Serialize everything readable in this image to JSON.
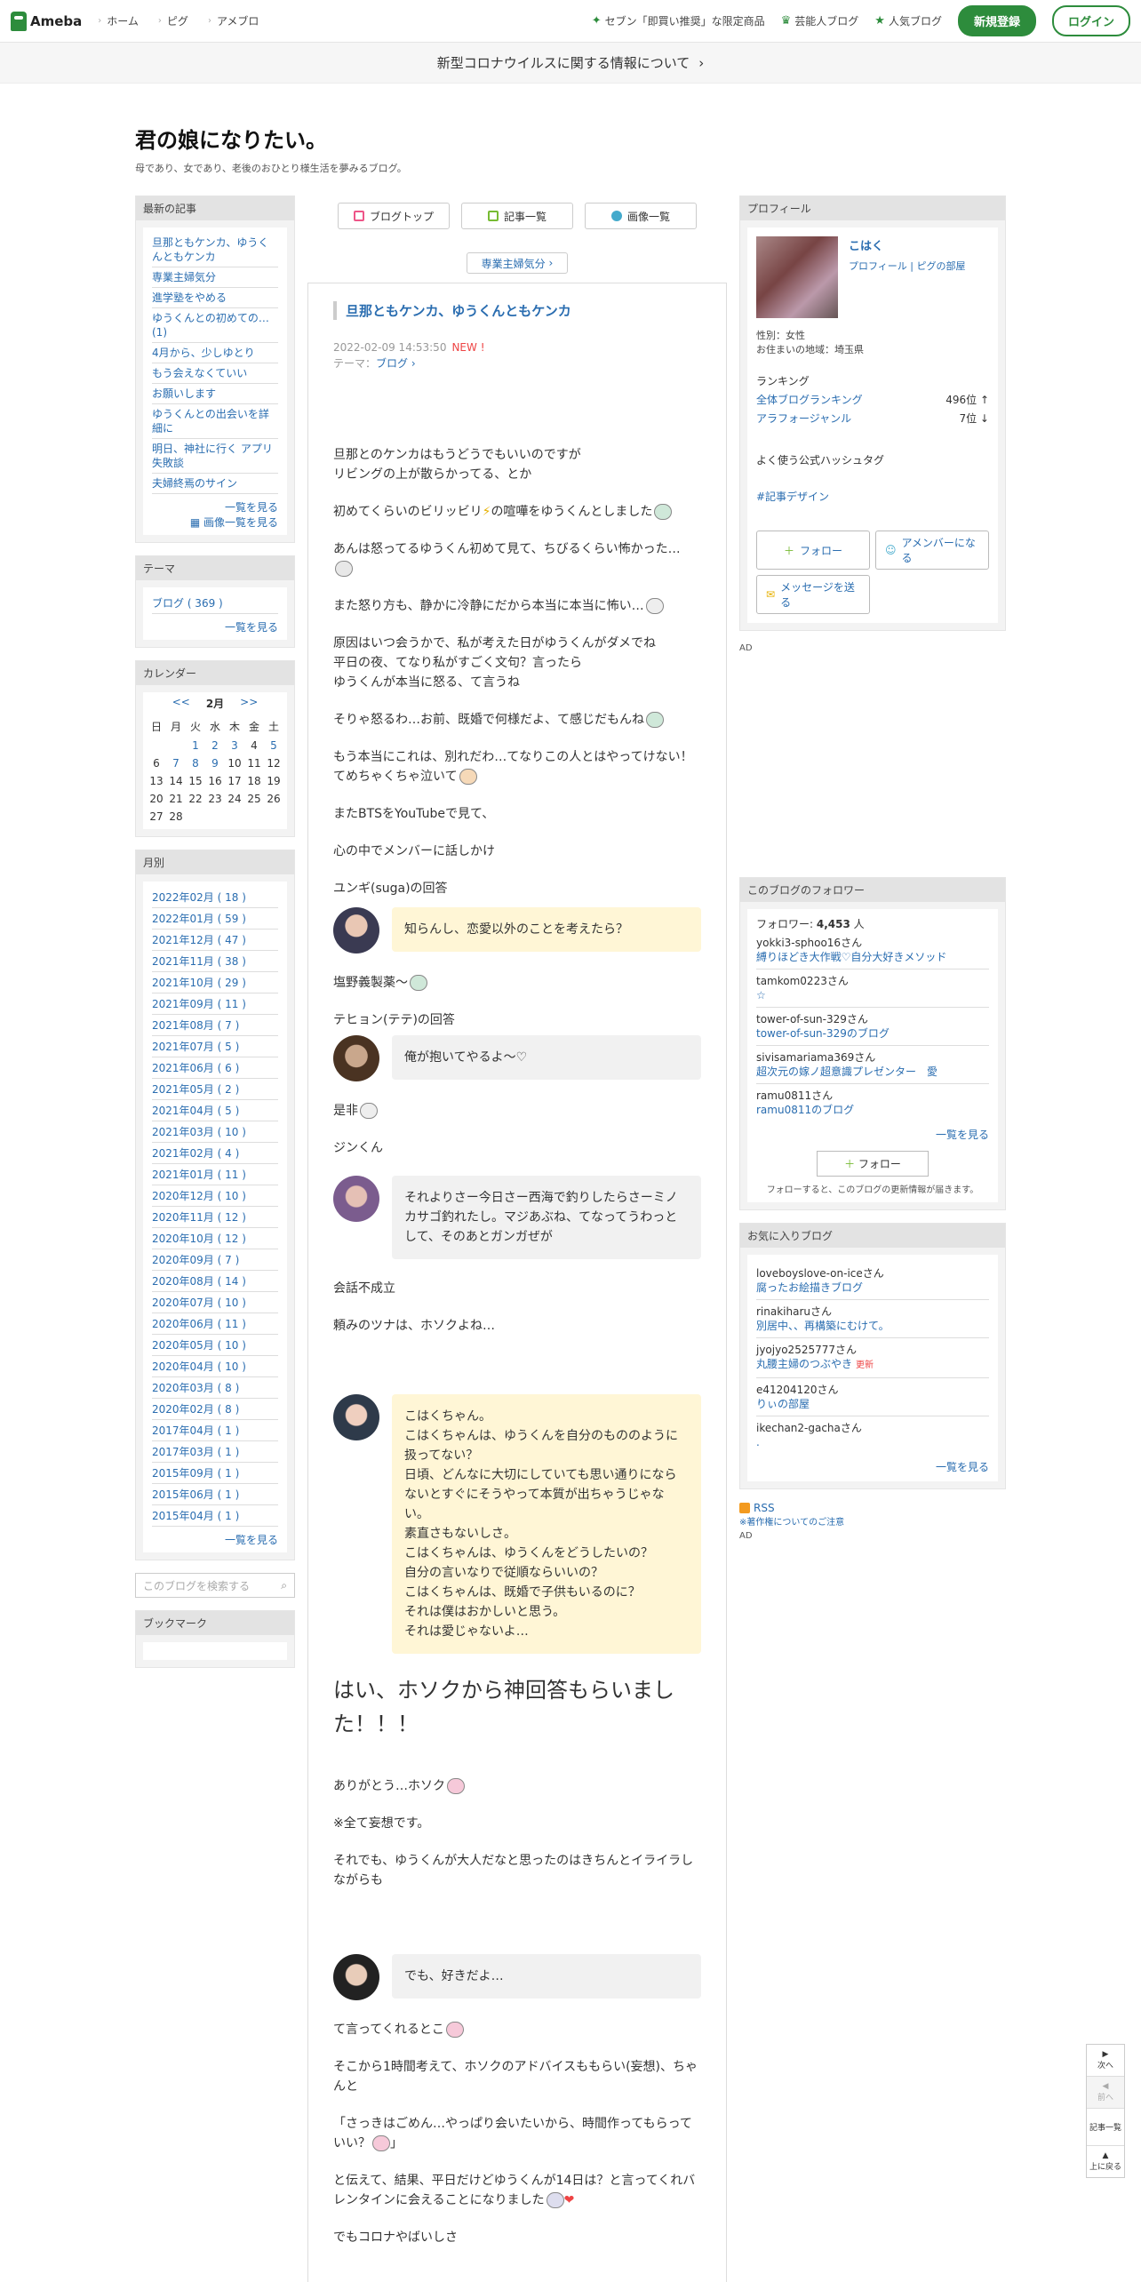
{
  "header": {
    "logo": "Ameba",
    "nav": [
      "ホーム",
      "ピグ",
      "アメブロ"
    ],
    "promos": [
      "セブン「即買い推奨」な限定商品",
      "芸能人ブログ",
      "人気ブログ"
    ],
    "register": "新規登録",
    "login": "ログイン"
  },
  "notice": "新型コロナウイルスに関する情報について",
  "blog": {
    "title": "君の娘になりたい。",
    "desc": "母であり、女であり、老後のおひとり様生活を夢みるブログ。"
  },
  "left": {
    "recent_title": "最新の記事",
    "recent": [
      "旦那ともケンカ、ゆうくんともケンカ",
      "専業主婦気分",
      "進学塾をやめる",
      "ゆうくんとの初めての…(1)",
      "4月から、少しゆとり",
      "もう会えなくていい",
      "お願いします",
      "ゆうくんとの出会いを詳細に",
      "明日、神社に行く アプリ失敗談",
      "夫婦終焉のサイン"
    ],
    "recent_more": "一覧を見る",
    "image_more": "画像一覧を見る",
    "theme_title": "テーマ",
    "theme_item": "ブログ ( 369 )",
    "theme_more": "一覧を見る",
    "calendar_title": "カレンダー",
    "cal_prev": "<<",
    "cal_month": "2月",
    "cal_next": ">>",
    "weekdays": [
      "日",
      "月",
      "火",
      "水",
      "木",
      "金",
      "土"
    ],
    "weeks": [
      [
        "",
        "",
        "1",
        "2",
        "3",
        "4",
        "5"
      ],
      [
        "6",
        "7",
        "8",
        "9",
        "10",
        "11",
        "12"
      ],
      [
        "13",
        "14",
        "15",
        "16",
        "17",
        "18",
        "19"
      ],
      [
        "20",
        "21",
        "22",
        "23",
        "24",
        "25",
        "26"
      ],
      [
        "27",
        "28",
        "",
        "",
        "",
        "",
        ""
      ]
    ],
    "monthly_title": "月別",
    "months": [
      "2022年02月 ( 18 )",
      "2022年01月 ( 59 )",
      "2021年12月 ( 47 )",
      "2021年11月 ( 38 )",
      "2021年10月 ( 29 )",
      "2021年09月 ( 11 )",
      "2021年08月 ( 7 )",
      "2021年07月 ( 5 )",
      "2021年06月 ( 6 )",
      "2021年05月 ( 2 )",
      "2021年04月 ( 5 )",
      "2021年03月 ( 10 )",
      "2021年02月 ( 4 )",
      "2021年01月 ( 11 )",
      "2020年12月 ( 10 )",
      "2020年11月 ( 12 )",
      "2020年10月 ( 12 )",
      "2020年09月 ( 7 )",
      "2020年08月 ( 14 )",
      "2020年07月 ( 10 )",
      "2020年06月 ( 11 )",
      "2020年05月 ( 10 )",
      "2020年04月 ( 10 )",
      "2020年03月 ( 8 )",
      "2020年02月 ( 8 )",
      "2017年04月 ( 1 )",
      "2017年03月 ( 1 )",
      "2015年09月 ( 1 )",
      "2015年06月 ( 1 )",
      "2015年04月 ( 1 )"
    ],
    "months_more": "一覧を見る",
    "search_placeholder": "このブログを検索する",
    "bookmark_title": "ブックマーク"
  },
  "center": {
    "tabs": [
      "ブログトップ",
      "記事一覧",
      "画像一覧"
    ],
    "theme_btn": "専業主婦気分",
    "title": "旦那ともケンカ、ゆうくんともケンカ",
    "date": "2022-02-09 14:53:50",
    "new": "NEW !",
    "theme": "テーマ：",
    "theme_link": "ブログ",
    "p1": "旦那とのケンカはもうどうでもいいのですが",
    "p1b": "リビングの上が散らかってる、とか",
    "p2": "初めてくらいのビリッビリ",
    "p2b": "の喧嘩をゆうくんとしました",
    "p3": "あんは怒ってるゆうくん初めて見て、ちびるくらい怖かった…",
    "p4": "また怒り方も、静かに冷静にだから本当に本当に怖い…",
    "p5a": "原因はいつ会うかで、私が考えた日がゆうくんがダメでね",
    "p5b": "平日の夜、てなり私がすごく文句？言ったら",
    "p5c": "ゆうくんが本当に怒る、て言うね",
    "p6": "そりゃ怒るわ…お前、既婚で何様だよ、て感じだもんね",
    "p7a": "もう本当にこれは、別れだわ…てなりこの人とはやってけない！",
    "p7b": "てめちゃくちゃ泣いて",
    "p8": "またBTSをYouTubeで見て、",
    "p9": "心の中でメンバーに話しかけ",
    "p10": "ユンギ(suga)の回答",
    "b1": "知らんし、恋愛以外のことを考えたら？",
    "p11": "塩野義製薬〜",
    "p12": "テヒョン(テテ)の回答",
    "b2": "俺が抱いてやるよ〜♡",
    "p13": "是非",
    "p14": "ジンくん",
    "b3": "それよりさー今日さー西海で釣りしたらさーミノカサゴ釣れたし。マジあぶね、てなってうわっとして、そのあとガンガぜが",
    "p15": "会話不成立",
    "p16": "頼みのツナは、ホソクよね…",
    "b4": [
      "こはくちゃん。",
      "こはくちゃんは、ゆうくんを自分のもののように扱ってない？",
      "日頃、どんなに大切にしていても思い通りにならないとすぐにそうやって本質が出ちゃうじゃない。",
      "素直さもないしさ。",
      "こはくちゃんは、ゆうくんをどうしたいの？",
      "自分の言いなりで従順ならいいの？",
      "こはくちゃんは、既婚で子供もいるのに？",
      "それは僕はおかしいと思う。",
      "それは愛じゃないよ…"
    ],
    "big": "はい、ホソクから神回答もらいました！！！",
    "p17": "ありがとう…ホソク",
    "p18": "※全て妄想です。",
    "p19": "それでも、ゆうくんが大人だなと思ったのはきちんとイライラしながらも",
    "b5": "でも、好きだよ…",
    "p20": "て言ってくれるとこ",
    "p21": "そこから1時間考えて、ホソクのアドバイスももらい(妄想)、ちゃんと",
    "p22": "「さっきはごめん…やっぱり会いたいから、時間作ってもらっていい？",
    "p22b": "」",
    "p23": "と伝えて、結果、平日だけどゆうくんが14日は？と言ってくれバレンタインに会えることになりました",
    "p24": "でもコロナやばいしさ"
  },
  "right": {
    "profile_title": "プロフィール",
    "name": "こはく",
    "profile_link": "プロフィール",
    "pig_link": "ピグの部屋",
    "sex": "性別：女性",
    "area": "お住まいの地域：埼玉県",
    "ranking": "ランキング",
    "rank1_label": "全体ブログランキング",
    "rank1_value": "496位 ↑",
    "rank2_label": "アラフォージャンル",
    "rank2_value": "7位 ↓",
    "hashtag_title": "よく使う公式ハッシュタグ",
    "hashtag": "#記事デザイン",
    "follow_btn": "フォロー",
    "member_btn": "アメンバーになる",
    "message_btn": "メッセージを送る",
    "ad": "AD",
    "followers_title": "このブログのフォロワー",
    "follower_count_label": "フォロワー:",
    "follower_count": "4,453",
    "follower_unit": "人",
    "followers": [
      {
        "name": "yokki3-sphoo16さん",
        "blog": "縛りほどき大作戦♡自分大好きメソッド"
      },
      {
        "name": "tamkom0223さん",
        "blog": "☆"
      },
      {
        "name": "tower-of-sun-329さん",
        "blog": "tower-of-sun-329のブログ"
      },
      {
        "name": "sivisamariama369さん",
        "blog": "超次元の嫁ノ超意識プレゼンター　愛"
      },
      {
        "name": "ramu0811さん",
        "blog": "ramu0811のブログ"
      }
    ],
    "followers_more": "一覧を見る",
    "follow_note": "フォローすると、このブログの更新情報が届きます。",
    "fav_title": "お気に入りブログ",
    "favs": [
      {
        "name": "loveboyslove-on-iceさん",
        "blog": "腐ったお絵描きブログ",
        "upd": ""
      },
      {
        "name": "rinakiharuさん",
        "blog": "別居中、、再構築にむけて。",
        "upd": ""
      },
      {
        "name": "jyojyo2525777さん",
        "blog": "丸腰主婦のつぶやき",
        "upd": "更新"
      },
      {
        "name": "e41204120さん",
        "blog": "りぃの部屋",
        "upd": ""
      },
      {
        "name": "ikechan2-gachaさん",
        "blog": ".",
        "upd": ""
      }
    ],
    "fav_more": "一覧を見る",
    "rss": "RSS",
    "rss_note": "※著作権についてのご注意",
    "ad2": "AD"
  },
  "floatnav": {
    "next": "次へ",
    "prev": "前へ",
    "list": "記事一覧",
    "top": "上に戻る"
  }
}
